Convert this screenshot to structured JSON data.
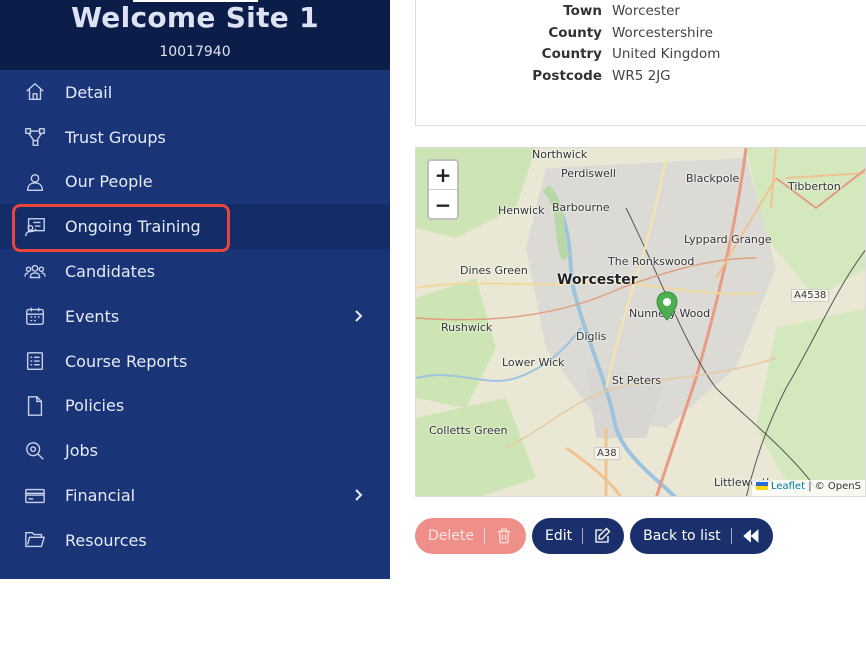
{
  "site": {
    "title": "Welcome Site 1",
    "id": "10017940"
  },
  "nav": {
    "items": [
      {
        "label": "Detail",
        "icon": "home-icon"
      },
      {
        "label": "Trust Groups",
        "icon": "hierarchy-icon"
      },
      {
        "label": "Our People",
        "icon": "person-icon"
      },
      {
        "label": "Ongoing Training",
        "icon": "training-icon"
      },
      {
        "label": "Candidates",
        "icon": "people-group-icon"
      },
      {
        "label": "Events",
        "icon": "calendar-icon",
        "has_submenu": true
      },
      {
        "label": "Course Reports",
        "icon": "report-icon"
      },
      {
        "label": "Policies",
        "icon": "document-icon"
      },
      {
        "label": "Jobs",
        "icon": "magnifier-icon"
      },
      {
        "label": "Financial",
        "icon": "card-icon",
        "has_submenu": true
      },
      {
        "label": "Resources",
        "icon": "folder-icon"
      }
    ],
    "highlighted": "Ongoing Training"
  },
  "address": {
    "rows": [
      {
        "key": "Town",
        "value": "Worcester"
      },
      {
        "key": "County",
        "value": "Worcestershire"
      },
      {
        "key": "Country",
        "value": "United Kingdom"
      },
      {
        "key": "Postcode",
        "value": "WR5 2JG"
      }
    ]
  },
  "map": {
    "zoom_in": "+",
    "zoom_out": "−",
    "labels": {
      "northwick": "Northwick",
      "perdiswell": "Perdiswell",
      "blackpole": "Blackpole",
      "tibberton": "Tibberton",
      "henwick": "Henwick",
      "barbourne": "Barbourne",
      "lyppard": "Lyppard Grange",
      "dines": "Dines Green",
      "ronkswood": "The Ronkswood",
      "worcester": "Worcester",
      "a4538": "A4538",
      "rushwick": "Rushwick",
      "nunnery": "Nunnery Wood",
      "diglis": "Diglis",
      "lowerwick": "Lower Wick",
      "stpeters": "St Peters",
      "colletts": "Colletts Green",
      "a38": "A38",
      "littleworth": "Littleworth"
    },
    "attribution_leaflet": "Leaflet",
    "attribution_rest": "| © OpenS"
  },
  "actions": {
    "delete": "Delete",
    "edit": "Edit",
    "back": "Back to list"
  },
  "colors": {
    "sidebar": "#1a3478",
    "header": "#0d1d4a",
    "highlight": "#e8453c",
    "button": "#1a2f6b",
    "delete": "#ee8f89"
  }
}
